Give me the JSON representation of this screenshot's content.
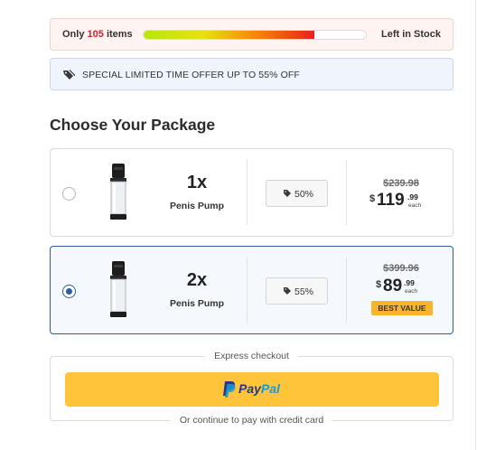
{
  "stock": {
    "prefix": "Only",
    "count": "105",
    "suffix": "items",
    "right_label": "Left in Stock",
    "fill_fraction": 0.77,
    "gradient_colors": [
      "#b8e60a",
      "#e8e20b",
      "#f28a0c",
      "#e8221a"
    ]
  },
  "offer": {
    "icon": "tag-icon",
    "text": "SPECIAL LIMITED TIME OFFER UP TO 55% OFF"
  },
  "heading": "Choose Your Package",
  "packages": [
    {
      "selected": false,
      "qty": "1x",
      "name": "Penis Pump",
      "discount": "50%",
      "old_price": "$239.98",
      "currency": "$",
      "price_main": "119",
      "price_cents": ".99",
      "each": "each",
      "badge": ""
    },
    {
      "selected": true,
      "qty": "2x",
      "name": "Penis Pump",
      "discount": "55%",
      "old_price": "$399.96",
      "currency": "$",
      "price_main": "89",
      "price_cents": ".99",
      "each": "each",
      "badge": "BEST VALUE"
    }
  ],
  "express": {
    "label": "Express checkout",
    "paypal_part1": "Pay",
    "paypal_part2": "Pal",
    "continue_label": "Or continue to pay with credit card"
  },
  "colors": {
    "accent": "#2d5d9f",
    "paypal_yellow": "#ffc439",
    "badge": "#f7b52a",
    "stock_red": "#d6202a"
  }
}
